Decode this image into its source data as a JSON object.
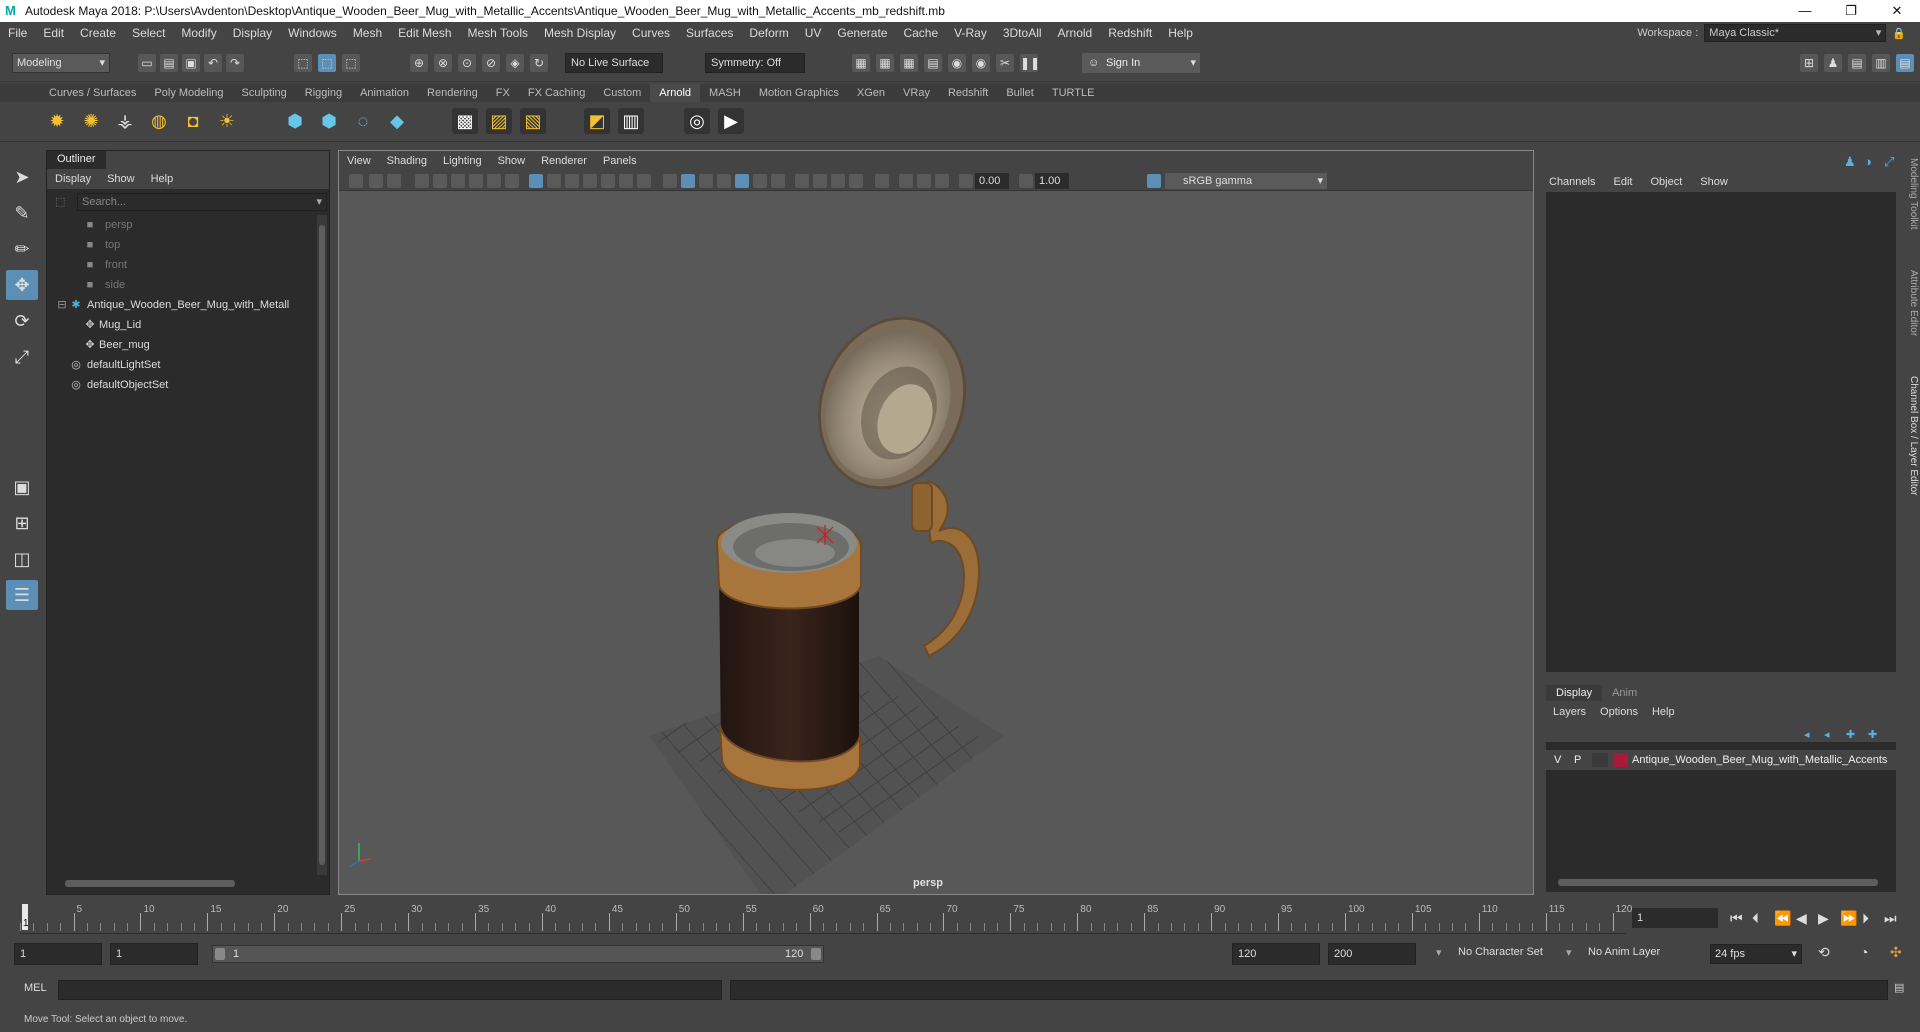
{
  "window": {
    "app_icon": "M",
    "title": "Autodesk Maya 2018: P:\\Users\\Avdenton\\Desktop\\Antique_Wooden_Beer_Mug_with_Metallic_Accents\\Antique_Wooden_Beer_Mug_with_Metallic_Accents_mb_redshift.mb",
    "controls": [
      "minimize-icon",
      "maximize-icon",
      "close-icon"
    ]
  },
  "menubar": {
    "items": [
      "File",
      "Edit",
      "Create",
      "Select",
      "Modify",
      "Display",
      "Windows",
      "Mesh",
      "Edit Mesh",
      "Mesh Tools",
      "Mesh Display",
      "Curves",
      "Surfaces",
      "Deform",
      "UV",
      "Generate",
      "Cache",
      "V-Ray",
      "3DtoAll",
      "Arnold",
      "Redshift",
      "Help"
    ],
    "workspace_label": "Workspace :",
    "workspace_value": "Maya Classic*"
  },
  "statusline": {
    "menuset": "Modeling",
    "live_surface": "No Live Surface",
    "symmetry": "Symmetry: Off",
    "sign_in": "Sign In"
  },
  "shelf": {
    "tabs": [
      "Curves / Surfaces",
      "Poly Modeling",
      "Sculpting",
      "Rigging",
      "Animation",
      "Rendering",
      "FX",
      "FX Caching",
      "Custom",
      "Arnold",
      "MASH",
      "Motion Graphics",
      "XGen",
      "VRay",
      "Redshift",
      "Bullet",
      "TURTLE"
    ],
    "active_tab": "Arnold"
  },
  "outliner": {
    "title": "Outliner",
    "menu": [
      "Display",
      "Show",
      "Help"
    ],
    "search_placeholder": "Search...",
    "items": [
      {
        "label": "persp",
        "type": "camera"
      },
      {
        "label": "top",
        "type": "camera"
      },
      {
        "label": "front",
        "type": "camera"
      },
      {
        "label": "side",
        "type": "camera"
      },
      {
        "label": "Antique_Wooden_Beer_Mug_with_Metall",
        "type": "group"
      },
      {
        "label": "Mug_Lid",
        "type": "mesh"
      },
      {
        "label": "Beer_mug",
        "type": "mesh"
      },
      {
        "label": "defaultLightSet",
        "type": "set"
      },
      {
        "label": "defaultObjectSet",
        "type": "set"
      }
    ]
  },
  "viewport": {
    "menu": [
      "View",
      "Shading",
      "Lighting",
      "Show",
      "Renderer",
      "Panels"
    ],
    "exposure": "0.00",
    "gamma": "1.00",
    "color_space": "sRGB gamma",
    "camera_label": "persp"
  },
  "channel_box": {
    "menu": [
      "Channels",
      "Edit",
      "Object",
      "Show"
    ]
  },
  "side_tabs": [
    "Modeling Toolkit",
    "Attribute Editor",
    "Channel Box / Layer Editor"
  ],
  "layer_editor": {
    "tabs": [
      "Display",
      "Anim"
    ],
    "menu": [
      "Layers",
      "Options",
      "Help"
    ],
    "layer": {
      "visible": "V",
      "playback": "P",
      "name": "Antique_Wooden_Beer_Mug_with_Metallic_Accents",
      "color": "#a81a3c"
    }
  },
  "timeslider": {
    "ticks": [
      5,
      10,
      15,
      20,
      25,
      30,
      35,
      40,
      45,
      50,
      55,
      60,
      65,
      70,
      75,
      80,
      85,
      90,
      95,
      100,
      105,
      110,
      115,
      120
    ],
    "current_frame_label": "1",
    "current_frame_field": "1"
  },
  "range": {
    "start": "1",
    "playback_start": "1",
    "bar_start": "1",
    "bar_end": "120",
    "playback_end": "120",
    "end": "200",
    "character_set": "No Character Set",
    "anim_layer": "No Anim Layer",
    "fps": "24 fps"
  },
  "cmdline": {
    "label": "MEL"
  },
  "helpline": {
    "text": "Move Tool: Select an object to move."
  }
}
